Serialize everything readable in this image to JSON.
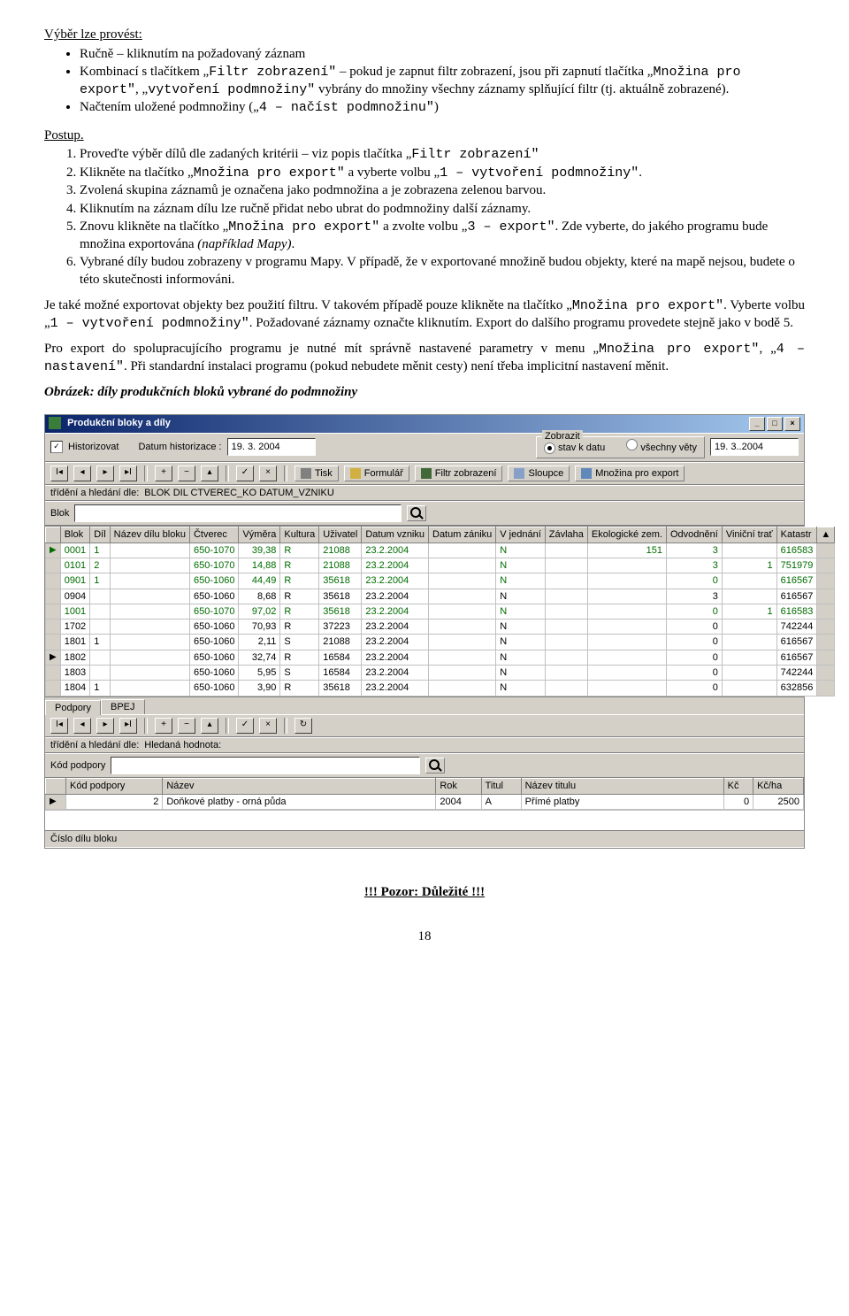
{
  "doc": {
    "heading1": "Výběr lze provést:",
    "bullets1": [
      "Ručně – kliknutím na požadovaný záznam",
      {
        "pre": "Kombinací s tlačítkem „",
        "mono1": "Filtr zobrazení\"",
        "mid1": " – pokud je zapnut filtr zobrazení, jsou při zapnutí tlačítka „",
        "mono2": "Množina pro export\"",
        "mid2": ", „",
        "mono3": "vytvoření podmnožiny\"",
        "post": " vybrány do množiny všechny záznamy splňující filtr (tj. aktuálně zobrazené)."
      },
      {
        "pre": "Načtením uložené podmnožiny („",
        "mono1": "4 – načíst podmnožinu\"",
        "post": ")"
      }
    ],
    "postup_label": "Postup.",
    "numbered": [
      {
        "pre": "Proveďte výběr dílů dle zadaných kritérii – viz popis tlačítka „",
        "mono1": "Filtr zobrazení\""
      },
      {
        "pre": "Klikněte na tlačítko „",
        "mono1": "Množina pro export\"",
        "mid1": " a vyberte volbu „",
        "mono2": "1 – vytvoření podmnožiny\"",
        "post": "."
      },
      "Zvolená skupina záznamů je označena jako podmnožina a je zobrazena zelenou barvou.",
      "Kliknutím na záznam dílu lze ručně přidat nebo ubrat do podmnožiny další záznamy.",
      {
        "pre": "Znovu klikněte na tlačítko „",
        "mono1": "Množina pro export\"",
        "mid1": " a zvolte volbu „",
        "mono2": "3 – export\"",
        "post": ". Zde vyberte, do jakého programu bude množina exportována ",
        "italic": "(například Mapy)",
        "post2": "."
      },
      "Vybrané díly budou zobrazeny v programu Mapy. V případě, že v exportované množině budou objekty, které na mapě nejsou, budete o této skutečnosti informováni."
    ],
    "para2": {
      "pre": "Je také možné exportovat objekty bez použití filtru. V takovém případě pouze klikněte na tlačítko „",
      "mono1": "Množina pro export\"",
      "mid1": ". Vyberte volbu „",
      "mono2": "1 – vytvoření podmnožiny\"",
      "post": ". Požadované záznamy označte kliknutím. Export do dalšího programu provedete stejně jako v bodě 5."
    },
    "para3": {
      "pre": "Pro export do spolupracujícího programu je nutné mít správně nastavené parametry v menu „",
      "mono1": "Množina pro export\"",
      "mid1": ", „",
      "mono2": "4 – nastavení\"",
      "post": ". Při standardní instalaci programu (pokud nebudete měnit cesty) není třeba implicitní nastavení měnit."
    },
    "caption": "Obrázek: díly produkčních bloků vybrané do podmnožiny",
    "warning": "!!! Pozor: Důležité !!!",
    "page": "18"
  },
  "app": {
    "title": "Produkční bloky a díly",
    "row1": {
      "historizovat": "Historizovat",
      "datum_hist_lbl": "Datum historizace :",
      "datum_hist_val": "19. 3. 2004",
      "zobrazit_legend": "Zobrazit",
      "radio_stav": "stav k datu",
      "radio_all": "všechny věty",
      "date2": "19. 3..2004"
    },
    "toolbtns": {
      "tisk": "Tisk",
      "formular": "Formulář",
      "filtr": "Filtr zobrazení",
      "sloupce": "Sloupce",
      "mnozina": "Množina pro export"
    },
    "row3_label": "třídění a hledání dle:",
    "row3_val": "BLOK   DIL   CTVEREC_KO DATUM_VZNIKU",
    "row4_label": "Blok",
    "grid": {
      "headers": [
        "Blok",
        "Díl",
        "Název dílu bloku",
        "Čtverec",
        "Výměra",
        "Kultura",
        "Uživatel",
        "Datum vzniku",
        "Datum zániku",
        "V jednání",
        "Závlaha",
        "Ekologické zem.",
        "Odvodnění",
        "Viniční trať",
        "Katastr"
      ],
      "rows": [
        {
          "mark": "▶",
          "sel": true,
          "c": [
            "0001",
            "1",
            "",
            "650-1070",
            "39,38",
            "R",
            "21088",
            "23.2.2004",
            "",
            "N",
            "",
            "151",
            "3",
            "",
            "616583"
          ]
        },
        {
          "mark": " ",
          "sel": true,
          "c": [
            "0101",
            "2",
            "",
            "650-1070",
            "14,88",
            "R",
            "21088",
            "23.2.2004",
            "",
            "N",
            "",
            "",
            "3",
            "1",
            "751979"
          ]
        },
        {
          "mark": " ",
          "sel": true,
          "c": [
            "0901",
            "1",
            "",
            "650-1060",
            "44,49",
            "R",
            "35618",
            "23.2.2004",
            "",
            "N",
            "",
            "",
            "0",
            "",
            "616567"
          ]
        },
        {
          "mark": " ",
          "sel": false,
          "c": [
            "0904",
            "",
            "",
            "650-1060",
            "8,68",
            "R",
            "35618",
            "23.2.2004",
            "",
            "N",
            "",
            "",
            "3",
            "",
            "616567"
          ]
        },
        {
          "mark": " ",
          "sel": true,
          "c": [
            "1001",
            "",
            "",
            "650-1070",
            "97,02",
            "R",
            "35618",
            "23.2.2004",
            "",
            "N",
            "",
            "",
            "0",
            "1",
            "616583"
          ]
        },
        {
          "mark": " ",
          "sel": false,
          "c": [
            "1702",
            "",
            "",
            "650-1060",
            "70,93",
            "R",
            "37223",
            "23.2.2004",
            "",
            "N",
            "",
            "",
            "0",
            "",
            "742244"
          ]
        },
        {
          "mark": " ",
          "sel": false,
          "c": [
            "1801",
            "1",
            "",
            "650-1060",
            "2,11",
            "S",
            "21088",
            "23.2.2004",
            "",
            "N",
            "",
            "",
            "0",
            "",
            "616567"
          ]
        },
        {
          "mark": "▶",
          "sel": false,
          "c": [
            "1802",
            "",
            "",
            "650-1060",
            "32,74",
            "R",
            "16584",
            "23.2.2004",
            "",
            "N",
            "",
            "",
            "0",
            "",
            "616567"
          ]
        },
        {
          "mark": " ",
          "sel": false,
          "c": [
            "1803",
            "",
            "",
            "650-1060",
            "5,95",
            "S",
            "16584",
            "23.2.2004",
            "",
            "N",
            "",
            "",
            "0",
            "",
            "742244"
          ]
        },
        {
          "mark": " ",
          "sel": false,
          "c": [
            "1804",
            "1",
            "",
            "650-1060",
            "3,90",
            "R",
            "35618",
            "23.2.2004",
            "",
            "N",
            "",
            "",
            "0",
            "",
            "632856"
          ]
        }
      ]
    },
    "tabs": [
      "Podpory",
      "BPEJ"
    ],
    "row6a": "třídění a hledání dle:",
    "row6a_val": "Hledaná hodnota:",
    "row6b": "Kód podpory",
    "grid2": {
      "headers": [
        "Kód podpory",
        "Název",
        "Rok",
        "Titul",
        "Název titulu",
        "Kč",
        "Kč/ha"
      ],
      "row": [
        "2",
        "Doňkové platby - orná půda",
        "2004",
        "A",
        "Přímé platby",
        "0",
        "2500"
      ]
    },
    "status": "Číslo dílu bloku"
  }
}
